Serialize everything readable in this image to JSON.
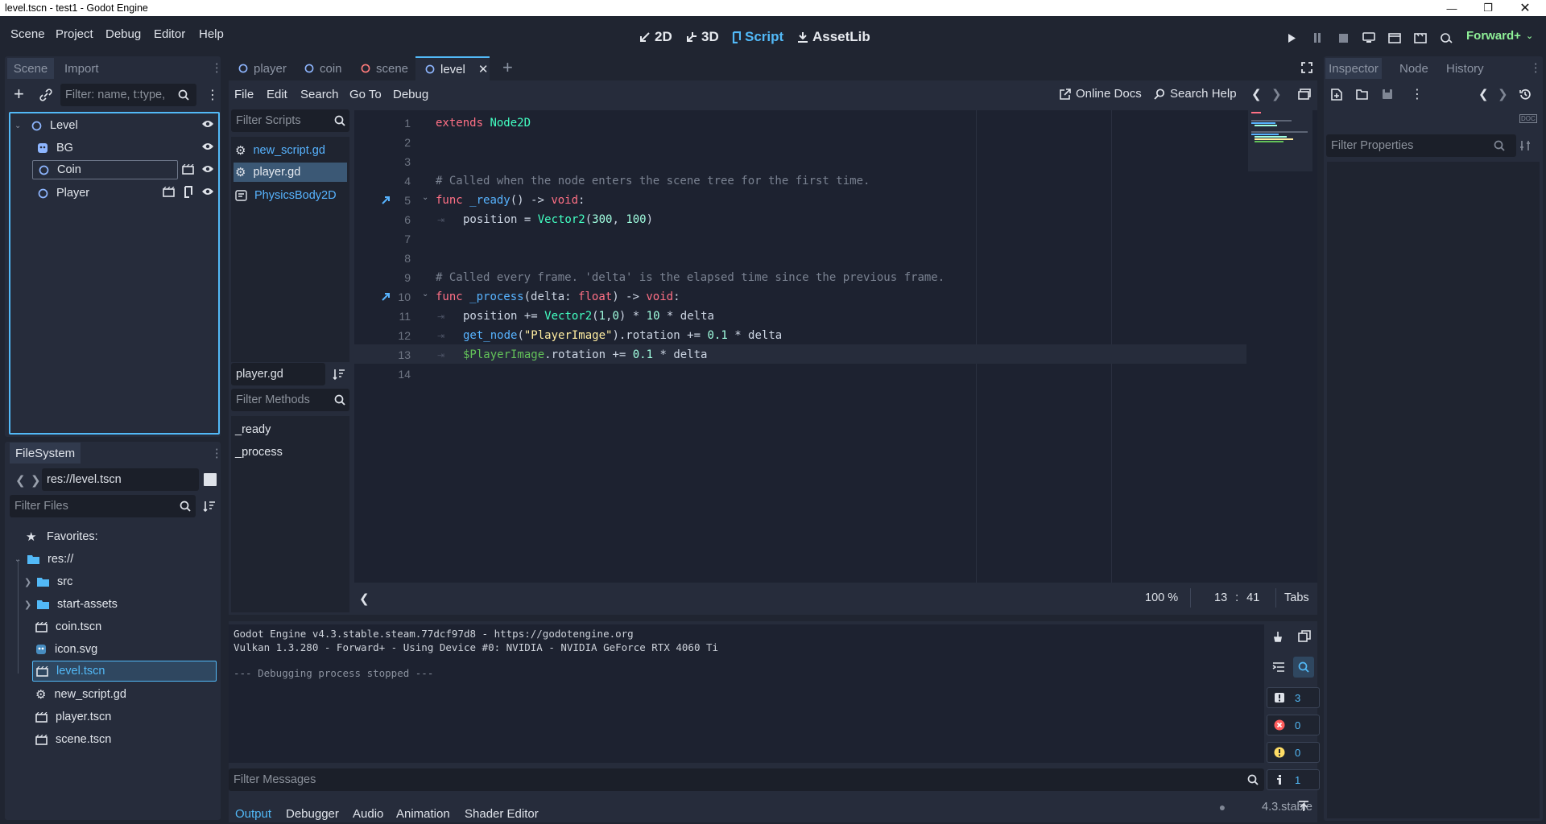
{
  "window": {
    "title": "level.tscn - test1 - Godot Engine"
  },
  "main_menu": [
    "Scene",
    "Project",
    "Debug",
    "Editor",
    "Help"
  ],
  "workspaces": {
    "w2d": "2D",
    "w3d": "3D",
    "script": "Script",
    "assetlib": "AssetLib"
  },
  "renderer": "Forward+",
  "scene_dock": {
    "tab_scene": "Scene",
    "tab_import": "Import",
    "filter_placeholder": "Filter: name, t:type,",
    "nodes": [
      "Level",
      "BG",
      "Coin",
      "Player"
    ]
  },
  "filesystem": {
    "title": "FileSystem",
    "path": "res://level.tscn",
    "filter_placeholder": "Filter Files",
    "favorites": "Favorites:",
    "root": "res://",
    "items": [
      "src",
      "start-assets",
      "coin.tscn",
      "icon.svg",
      "level.tscn",
      "new_script.gd",
      "player.tscn",
      "scene.tscn"
    ]
  },
  "scene_tabs": [
    "player",
    "coin",
    "scene",
    "level"
  ],
  "script_menu": [
    "File",
    "Edit",
    "Search",
    "Go To",
    "Debug"
  ],
  "script_toolbar": {
    "online_docs": "Online Docs",
    "search_help": "Search Help"
  },
  "script_list": {
    "filter_placeholder": "Filter Scripts",
    "items": [
      "new_script.gd",
      "player.gd",
      "PhysicsBody2D"
    ],
    "current": "player.gd",
    "methods_placeholder": "Filter Methods",
    "methods": [
      "_ready",
      "_process"
    ]
  },
  "code_lines": [
    {
      "n": "1",
      "text": "extends Node2D"
    },
    {
      "n": "2",
      "text": ""
    },
    {
      "n": "3",
      "text": ""
    },
    {
      "n": "4",
      "text": "# Called when the node enters the scene tree for the first time."
    },
    {
      "n": "5",
      "text": "func _ready() -> void:"
    },
    {
      "n": "6",
      "text": "position = Vector2(300, 100)"
    },
    {
      "n": "7",
      "text": ""
    },
    {
      "n": "8",
      "text": ""
    },
    {
      "n": "9",
      "text": "# Called every frame. 'delta' is the elapsed time since the previous frame."
    },
    {
      "n": "10",
      "text": "func _process(delta: float) -> void:"
    },
    {
      "n": "11",
      "text": "position += Vector2(1,0) * 10 * delta"
    },
    {
      "n": "12",
      "text": "get_node(\"PlayerImage\").rotation += 0.1 * delta"
    },
    {
      "n": "13",
      "text": "$PlayerImage.rotation += 0.1 * delta"
    },
    {
      "n": "14",
      "text": ""
    }
  ],
  "editor_status": {
    "zoom": "100 %",
    "line": "13",
    "sep": ":",
    "col": "41",
    "indent": "Tabs"
  },
  "output": {
    "lines": [
      "Godot Engine v4.3.stable.steam.77dcf97d8 - https://godotengine.org",
      "Vulkan 1.3.280 - Forward+ - Using Device #0: NVIDIA - NVIDIA GeForce RTX 4060 Ti",
      "",
      "--- Debugging process stopped ---"
    ],
    "filter_placeholder": "Filter Messages",
    "counts": {
      "messages": "3",
      "errors": "0",
      "warnings": "0",
      "editor": "1"
    }
  },
  "bottom_tabs": [
    "Output",
    "Debugger",
    "Audio",
    "Animation",
    "Shader Editor"
  ],
  "version": "4.3.stable",
  "inspector": {
    "tabs": [
      "Inspector",
      "Node",
      "History"
    ],
    "filter_placeholder": "Filter Properties"
  },
  "colors": {
    "accent": "#52b9f7",
    "background": "#202531",
    "panel": "#262c3b",
    "renderer": "#8eef97"
  }
}
